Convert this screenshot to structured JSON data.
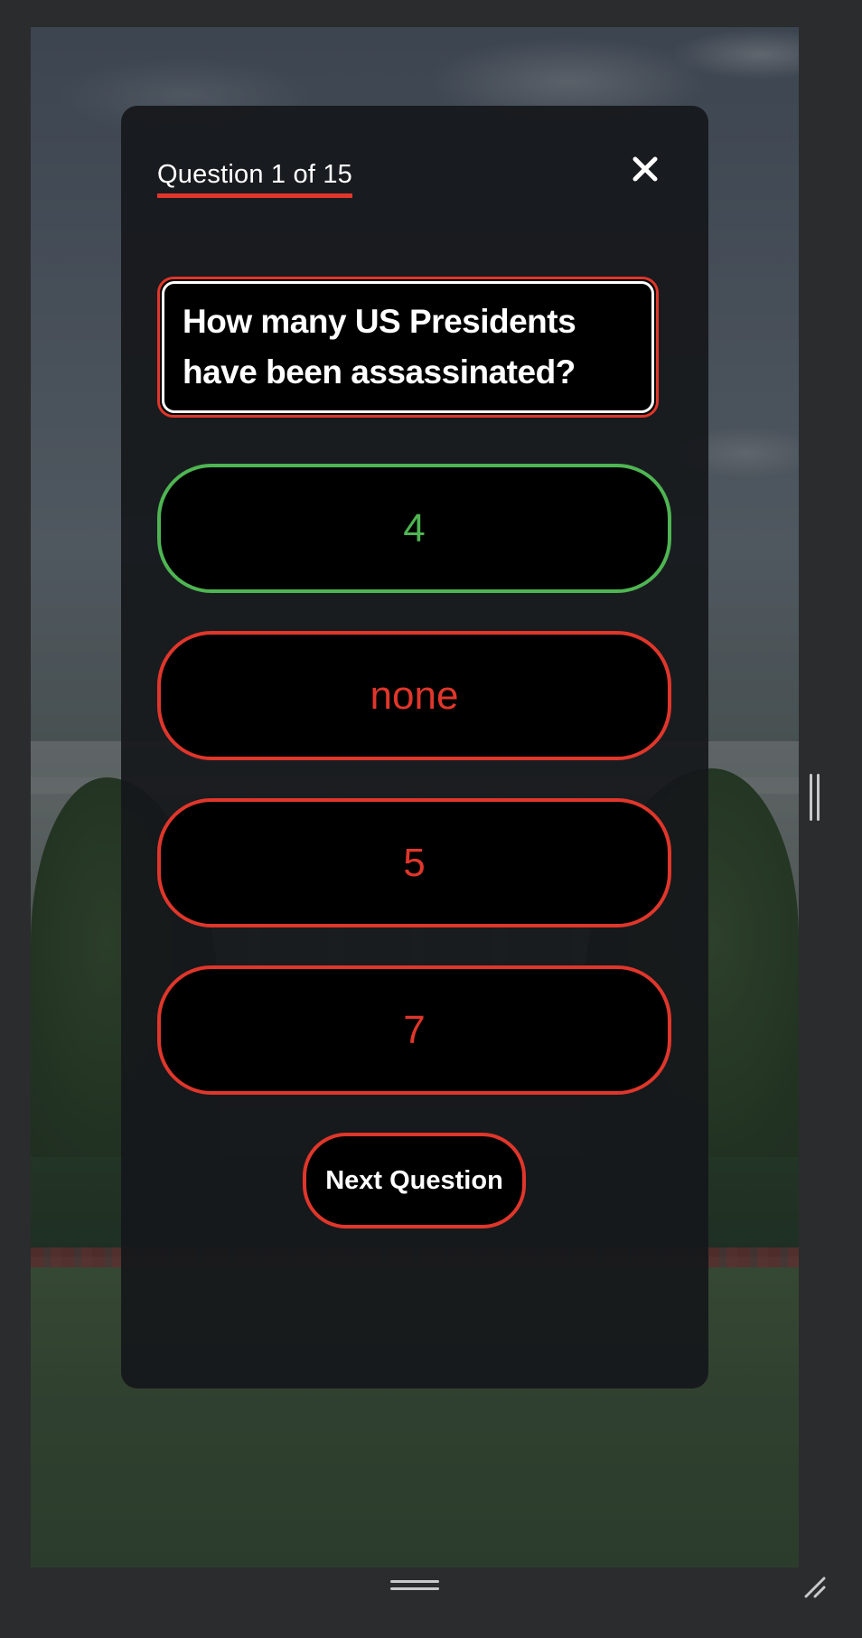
{
  "quiz": {
    "progress_label": "Question 1 of 15",
    "current_question": 1,
    "total_questions": 15,
    "question": "How many US Presidents have been assassinated?",
    "answers": [
      {
        "label": "4",
        "state": "correct"
      },
      {
        "label": "none",
        "state": "wrong"
      },
      {
        "label": "5",
        "state": "wrong"
      },
      {
        "label": "7",
        "state": "wrong"
      }
    ],
    "next_label": "Next Question"
  },
  "icons": {
    "close": "close-icon",
    "side_handle": "vertical-resize-handle-icon",
    "bottom_handle": "horizontal-resize-handle-icon",
    "corner": "corner-resize-icon"
  },
  "colors": {
    "accent_red": "#e0362b",
    "correct_green": "#4eb552",
    "modal_bg": "#16181b",
    "text_white": "#ffffff"
  }
}
